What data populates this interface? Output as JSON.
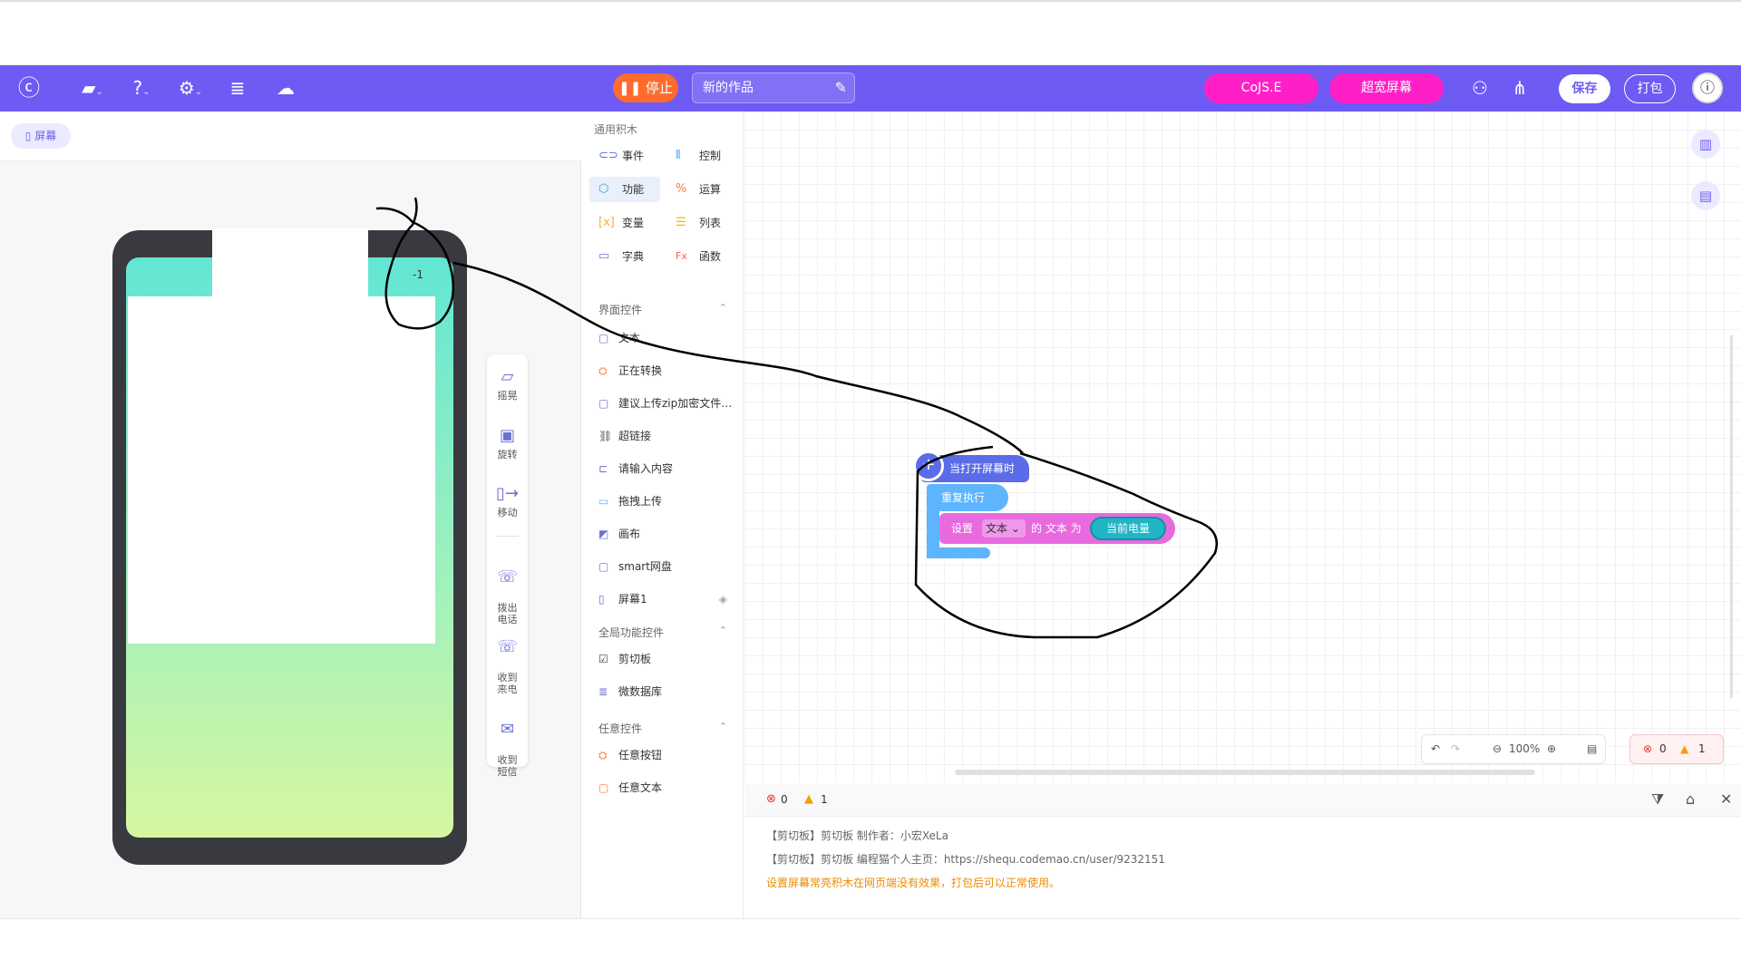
{
  "colors": {
    "toolbar": "#6d5bf4",
    "stop": "#ff6b2c",
    "pink": "#ff1fc8",
    "hat_block": "#5b6ce8",
    "loop_block": "#5fb4ff",
    "set_block": "#e86adf",
    "value_block": "#20b4c7"
  },
  "toolbar": {
    "logo_icon": "codemao-logo-icon",
    "file_icon": "folder-icon",
    "help_icon": "help-icon",
    "settings_icon": "gear-icon",
    "data_icon": "database-icon",
    "cloud_icon": "cloud-alert-icon",
    "stop_label": "停止",
    "project_title": "新的作品",
    "cojse_label": "CoJS.E",
    "wide_screen_label": "超宽屏幕",
    "save_label": "保存",
    "pack_label": "打包"
  },
  "left": {
    "screen_tab": "屏幕",
    "status_number": "-1",
    "side_tools": [
      {
        "icon": "shake-icon",
        "label": "摇晃"
      },
      {
        "icon": "rotate-icon",
        "label": "旋转"
      },
      {
        "icon": "move-icon",
        "label": "移动"
      },
      {
        "icon": "phone-call-icon",
        "label": "拨出\n电话"
      },
      {
        "icon": "phone-incoming-icon",
        "label": "收到\n来电"
      },
      {
        "icon": "sms-icon",
        "label": "收到\n短信"
      }
    ]
  },
  "palette": {
    "general_title": "通用积木",
    "categories": [
      {
        "label": "事件",
        "icon": "event-icon"
      },
      {
        "label": "控制",
        "icon": "control-icon"
      },
      {
        "label": "功能",
        "icon": "function-icon"
      },
      {
        "label": "运算",
        "icon": "operator-icon"
      },
      {
        "label": "变量",
        "icon": "variable-icon"
      },
      {
        "label": "列表",
        "icon": "list-icon"
      },
      {
        "label": "字典",
        "icon": "dictionary-icon"
      },
      {
        "label": "函数",
        "icon": "fx-icon"
      }
    ],
    "ui_section": "界面控件",
    "ui_items": [
      "文本",
      "正在转换",
      "建议上传zip加密文件…",
      "超链接",
      "请输入内容",
      "拖拽上传",
      "画布",
      "smart网盘",
      "屏幕1"
    ],
    "global_section": "全局功能控件",
    "global_items": [
      "剪切板",
      "微数据库"
    ],
    "any_section": "任意控件",
    "any_items": [
      "任意按钮",
      "任意文本"
    ]
  },
  "workspace": {
    "hat_label": "当打开屏幕时",
    "loop_label": "重复执行",
    "set_prefix": "设置",
    "set_target": "文本",
    "set_middle": "的 文本 为",
    "set_value": "当前电量",
    "zoom": "100%",
    "errors": "0",
    "warnings": "1"
  },
  "console": {
    "errors": "0",
    "warnings": "1",
    "lines": [
      "【剪切板】剪切板 制作者：小宏XeLa",
      "【剪切板】剪切板 编程猫个人主页：https://shequ.codemao.cn/user/9232151"
    ],
    "warning_line": "设置屏幕常亮积木在网页端没有效果，打包后可以正常使用。"
  }
}
